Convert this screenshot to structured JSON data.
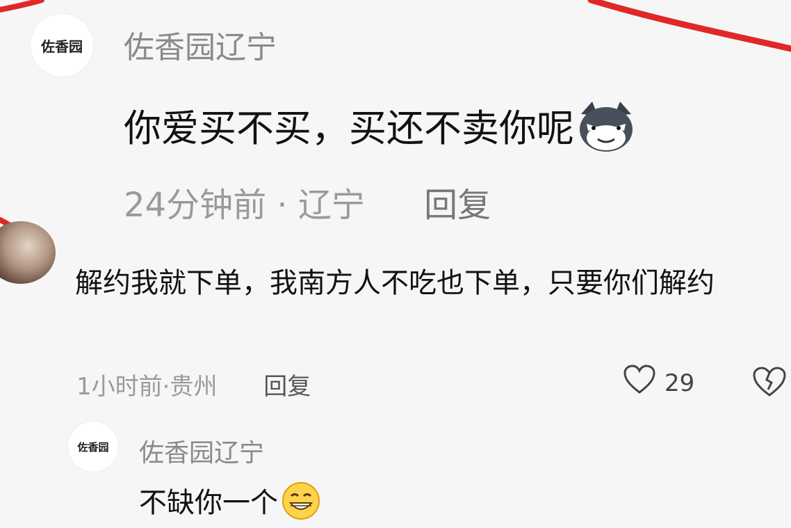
{
  "comments": [
    {
      "avatar_text": "佐香园",
      "username": "佐香园辽宁",
      "text": "你爱买不买，买还不卖你呢",
      "emoji": "smug-cat-emoji",
      "time": "24分钟前",
      "separator": "·",
      "location": "辽宁",
      "reply_label": "回复"
    },
    {
      "username": "",
      "text": "解约我就下单，我南方人不吃也下单，只要你们解约",
      "time": "1小时前",
      "separator": "·",
      "location": "贵州",
      "reply_label": "回复",
      "likes": "29"
    },
    {
      "avatar_text": "佐香园",
      "username": "佐香园辽宁",
      "text": "不缺你一个",
      "emoji": "grin-emoji"
    }
  ],
  "colors": {
    "background": "#f6f6f6",
    "decoration_line": "#e02828",
    "username": "#8a8a8a",
    "text": "#111111"
  }
}
